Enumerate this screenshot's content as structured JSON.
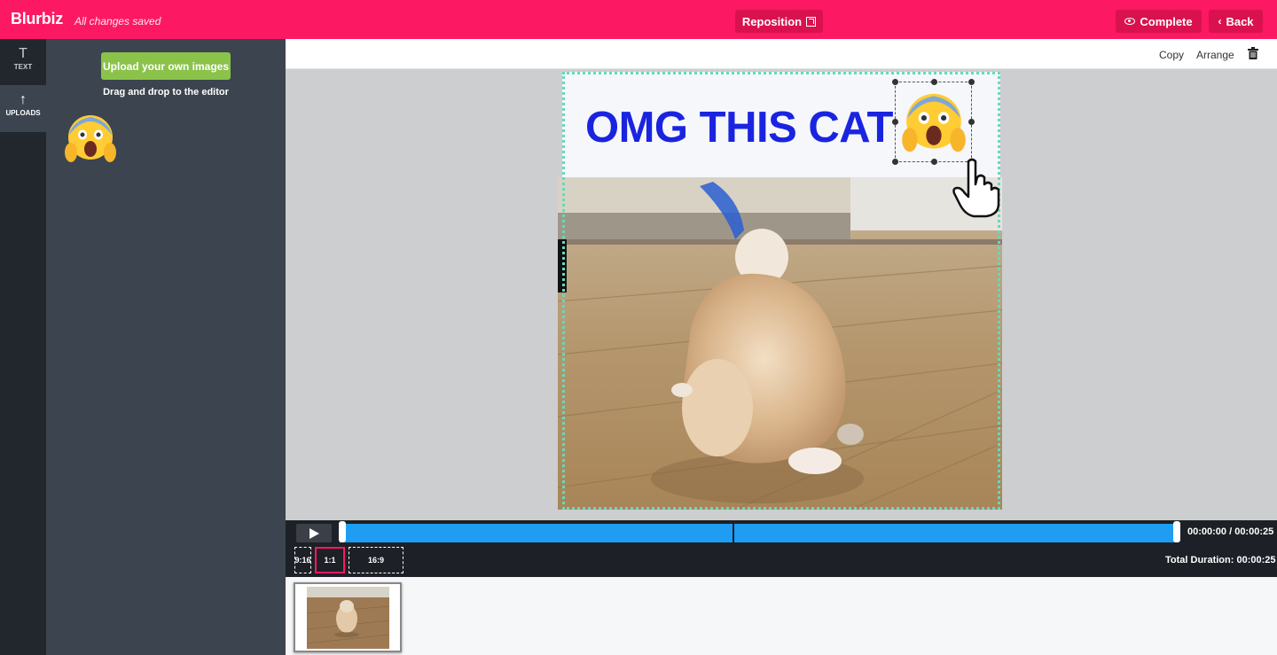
{
  "app": {
    "logo": "Blurbiz",
    "status": "All changes saved"
  },
  "header": {
    "reposition_label": "Reposition",
    "complete_label": "Complete",
    "back_label": "Back"
  },
  "rail": {
    "text_label": "TEXT",
    "uploads_label": "UPLOADS"
  },
  "panel": {
    "upload_button": "Upload your own images",
    "drag_hint": "Drag and drop to the editor"
  },
  "toolbar": {
    "copy_label": "Copy",
    "arrange_label": "Arrange"
  },
  "canvas": {
    "headline": "OMG THIS CAT",
    "emoji": "face-screaming-in-fear"
  },
  "timeline": {
    "time_readout": "00:00:00 / 00:00:25",
    "ratios": [
      "9:16",
      "1:1",
      "16:9"
    ],
    "selected_ratio": "1:1",
    "total_duration": "Total Duration: 00:00:25"
  },
  "colors": {
    "brand": "#fc1863",
    "accent_green": "#8bc34a",
    "track": "#1e9df2",
    "headline": "#1a24e0",
    "selection": "#67d9bb"
  }
}
